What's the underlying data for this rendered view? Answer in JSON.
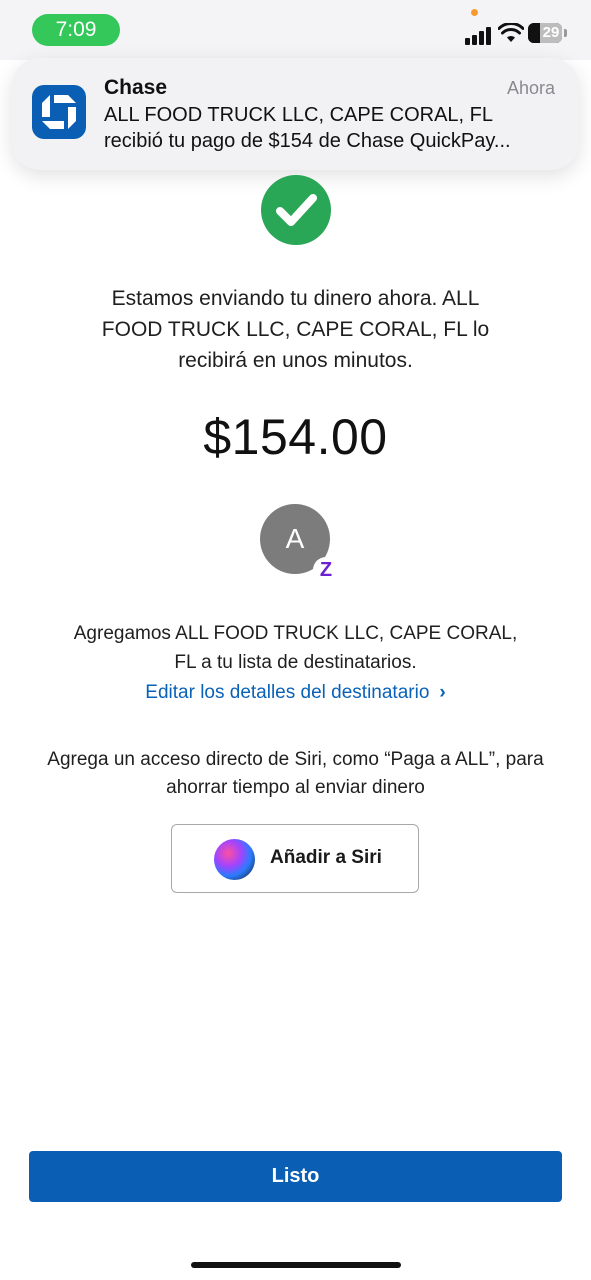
{
  "status_bar": {
    "time": "7:09",
    "battery_level": "29",
    "colors": {
      "time_pill": "#34c759",
      "privacy_dot": "#f79a2e"
    }
  },
  "notification": {
    "app_name": "Chase",
    "time": "Ahora",
    "body_line1": "ALL FOOD TRUCK LLC, CAPE CORAL, FL",
    "body_line2": "recibió tu pago de $154 de Chase QuickPay...",
    "icon": "chase-logo-icon"
  },
  "main": {
    "success_icon": "check-circle-icon",
    "message_line1": "Estamos enviando tu dinero ahora. ALL",
    "message_line2": "FOOD TRUCK LLC, CAPE CORAL, FL lo",
    "message_line3": "recibirá en unos minutos.",
    "amount": "$154.00",
    "avatar_initial": "A",
    "zelle_badge": "Z",
    "added_line1": "Agregamos ALL FOOD TRUCK LLC, CAPE CORAL,",
    "added_line2": "FL a tu lista de destinatarios.",
    "edit_link": "Editar los detalles del destinatario",
    "siri_line1": "Agrega un acceso directo de Siri, como “Paga a ALL”, para",
    "siri_line2": "ahorrar tiempo al enviar dinero",
    "siri_button": "Añadir a Siri",
    "done_button": "Listo"
  },
  "colors": {
    "brand_blue": "#0a5fb4",
    "link_blue": "#0a62b8",
    "success_green": "#2aa657",
    "zelle_purple": "#6d1ed4"
  }
}
